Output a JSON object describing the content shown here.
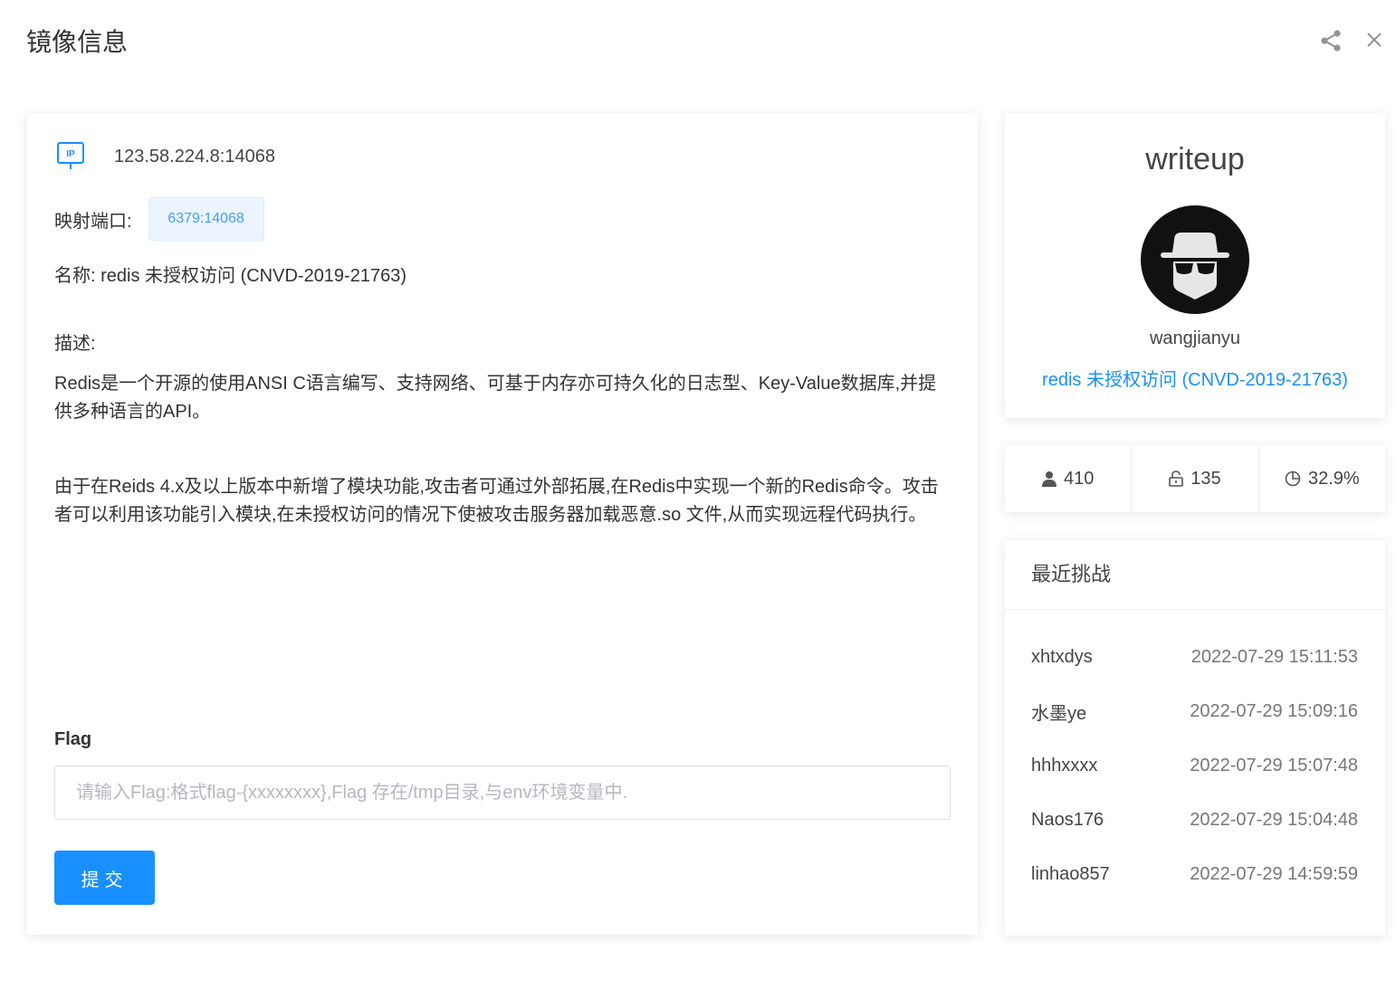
{
  "header": {
    "title": "镜像信息"
  },
  "ip": {
    "icon_text": "IP",
    "address": "123.58.224.8:14068"
  },
  "port": {
    "label": "映射端口:",
    "value": "6379:14068"
  },
  "name": {
    "text": "名称: redis 未授权访问 (CNVD-2019-21763)"
  },
  "description": {
    "label": "描述:",
    "paragraph1": "Redis是一个开源的使用ANSI C语言编写、支持网络、可基于内存亦可持久化的日志型、Key-Value数据库,并提供多种语言的API。",
    "paragraph2": "由于在Reids 4.x及以上版本中新增了模块功能,攻击者可通过外部拓展,在Redis中实现一个新的Redis命令。攻击者可以利用该功能引入模块,在未授权访问的情况下使被攻击服务器加载恶意.so 文件,从而实现远程代码执行。"
  },
  "flag": {
    "label": "Flag",
    "placeholder": "请输入Flag:格式flag-{xxxxxxxx},Flag 存在/tmp目录,与env环境变量中.",
    "value": "",
    "submit_label": "提交"
  },
  "writeup": {
    "title": "writeup",
    "username": "wangjianyu",
    "link": "redis 未授权访问 (CNVD-2019-21763)"
  },
  "stats": {
    "users": "410",
    "solved": "135",
    "rate": "32.9%"
  },
  "recent": {
    "title": "最近挑战",
    "items": [
      {
        "name": "xhtxdys",
        "time": "2022-07-29 15:11:53"
      },
      {
        "name": "水墨ye",
        "time": "2022-07-29 15:09:16"
      },
      {
        "name": "hhhxxxx",
        "time": "2022-07-29 15:07:48"
      },
      {
        "name": "Naos176",
        "time": "2022-07-29 15:04:48"
      },
      {
        "name": "linhao857",
        "time": "2022-07-29 14:59:59"
      }
    ]
  },
  "colors": {
    "accent": "#1890ff",
    "tag_bg": "#ecf5ff",
    "icon_gray": "#909399"
  }
}
